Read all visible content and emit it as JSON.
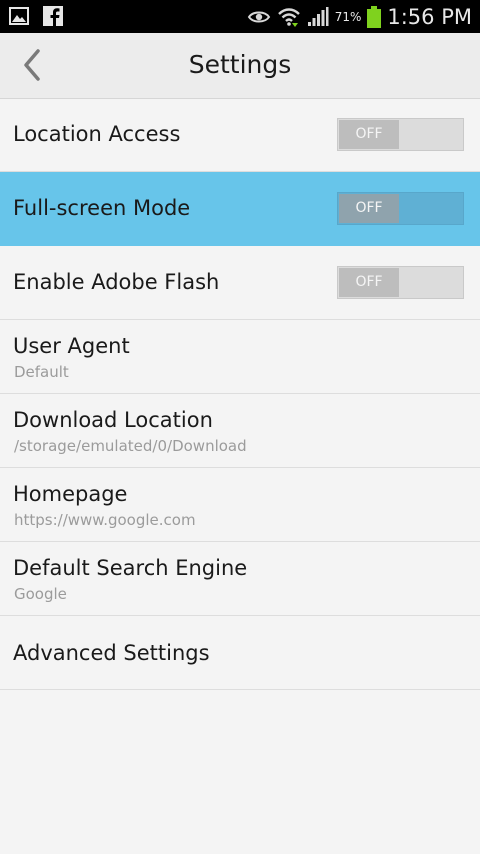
{
  "status_bar": {
    "battery_percent": "71%",
    "time": "1:56 PM",
    "icons": [
      "gallery-icon",
      "facebook-icon",
      "eye-icon",
      "wifi-icon",
      "signal-icon",
      "battery-icon"
    ]
  },
  "header": {
    "title": "Settings",
    "back_icon": "chevron-left-icon"
  },
  "settings": [
    {
      "title": "Location Access",
      "toggle": "OFF"
    },
    {
      "title": "Full-screen Mode",
      "toggle": "OFF",
      "highlighted": true
    },
    {
      "title": "Enable Adobe Flash",
      "toggle": "OFF"
    },
    {
      "title": "User Agent",
      "subtitle": "Default"
    },
    {
      "title": "Download Location",
      "subtitle": "/storage/emulated/0/Download"
    },
    {
      "title": "Homepage",
      "subtitle": "https://www.google.com"
    },
    {
      "title": "Default Search Engine",
      "subtitle": "Google"
    },
    {
      "title": "Advanced Settings"
    }
  ],
  "colors": {
    "highlight": "#67c5ea",
    "status_bar_bg": "#000000",
    "title_bar_bg": "#ececec",
    "battery_green": "#7fd21e"
  }
}
